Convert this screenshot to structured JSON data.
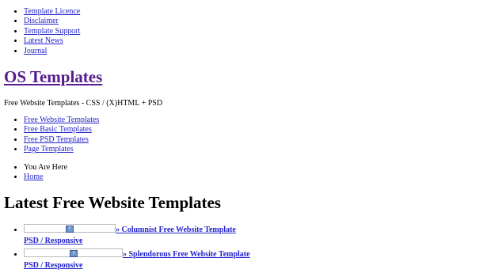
{
  "top_nav": [
    "Template Licence",
    "Disclaimer",
    "Template Support",
    "Latest News",
    "Journal"
  ],
  "site": {
    "title": "OS Templates",
    "tagline": "Free Website Templates - CSS / (X)HTML + PSD"
  },
  "main_nav": [
    "Free Website Templates",
    "Free Basic Templates",
    "Free PSD Templates",
    "Page Templates"
  ],
  "breadcrumb": {
    "label": "You Are Here",
    "home": "Home"
  },
  "page_heading": "Latest Free Website Templates",
  "templates": [
    {
      "link": "» Columnist Free Website Template",
      "tags": "PSD / Responsive",
      "icon": "broken-image-icon"
    },
    {
      "link": "» Splendorous Free Website Template",
      "tags": "PSD / Responsive",
      "icon": "broken-image-icon"
    }
  ]
}
